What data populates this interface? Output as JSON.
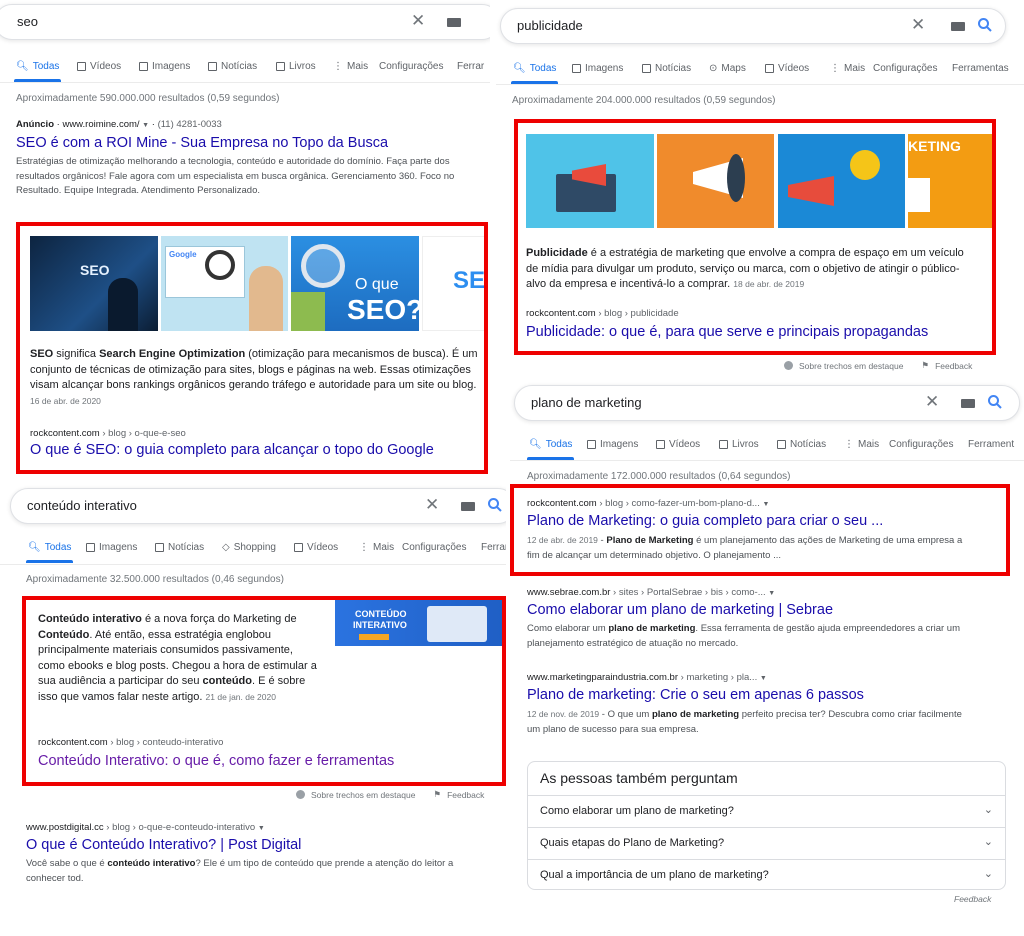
{
  "colors": {
    "link": "#1a0dab",
    "visited": "#681da8",
    "accent": "#1a73e8",
    "highlight_box": "#ee0000"
  },
  "p1": {
    "query": "seo",
    "tabs": [
      "Todas",
      "Vídeos",
      "Imagens",
      "Notícias",
      "Livros",
      "Mais",
      "Configurações",
      "Ferrar"
    ],
    "stats": "Aproximadamente 590.000.000 resultados (0,59 segundos)",
    "ad": {
      "label": "Anúncio",
      "url": "www.roimine.com/",
      "phone": "(11) 4281-0033",
      "title": "SEO é com a ROI Mine - Sua Empresa no Topo da Busca",
      "snippet": "Estratégias de otimização melhorando a tecnologia, conteúdo e autoridade do domínio. Faça parte dos resultados orgânicos! Fale agora com um especialista em busca orgânica. Gerenciamento 360. Foco no Resultado. Equipe Integrada. Atendimento Personalizado."
    },
    "featured": {
      "img_text_1": "SEO",
      "img_text_2": "Google",
      "img_text_3": "O que",
      "img_text_4": "SEO?",
      "img_text_5": "SE",
      "s_bold1": "SEO",
      "s_text1": " significa ",
      "s_bold2": "Search Engine Optimization",
      "s_text2": " (otimização para mecanismos de busca). É um conjunto de técnicas de otimização para sites, blogs e páginas na web. Essas otimizações visam alcançar bons rankings orgânicos gerando tráfego e autoridade para um site ou blog.",
      "date": "16 de abr. de 2020",
      "cite_domain": "rockcontent.com",
      "cite_path": " › blog › o-que-e-seo",
      "title": "O que é SEO: o guia completo para alcançar o topo do Google"
    }
  },
  "p2": {
    "query": "publicidade",
    "tabs": [
      "Todas",
      "Imagens",
      "Notícias",
      "Maps",
      "Vídeos",
      "Mais",
      "Configurações",
      "Ferramentas"
    ],
    "stats": "Aproximadamente 204.000.000 resultados (0,59 segundos)",
    "featured": {
      "img_text_4": "KETING",
      "s_bold1": "Publicidade",
      "s_text1": " é a estratégia de marketing que envolve a compra de espaço em um veículo de mídia para divulgar um produto, serviço ou marca, com o objetivo de atingir o público-alvo da empresa e incentivá-lo a comprar.",
      "date": "18 de abr. de 2019",
      "cite_domain": "rockcontent.com",
      "cite_path": " › blog › publicidade",
      "title": "Publicidade: o que é, para que serve e principais propagandas"
    },
    "about": "Sobre trechos em destaque",
    "feedback": "Feedback"
  },
  "p3": {
    "query": "conteúdo interativo",
    "tabs": [
      "Todas",
      "Imagens",
      "Notícias",
      "Shopping",
      "Vídeos",
      "Mais",
      "Configurações",
      "Ferram"
    ],
    "stats": "Aproximadamente 32.500.000 resultados (0,46 segundos)",
    "featured": {
      "img_line1": "CONTEÚDO",
      "img_line2": "INTERATIVO",
      "s_bold1": "Conteúdo interativo",
      "s_text1": " é a nova força do Marketing de ",
      "s_bold2": "Conteúdo",
      "s_text2": ". Até então, essa estratégia englobou principalmente materiais consumidos passivamente, como ebooks e blog posts. Chegou a hora de estimular a sua audiência a participar do seu ",
      "s_bold3": "conteúdo",
      "s_text3": ". E é sobre isso que vamos falar neste artigo.",
      "date": "21 de jan. de 2020",
      "cite_domain": "rockcontent.com",
      "cite_path": " › blog › conteudo-interativo",
      "title": "Conteúdo Interativo: o que é, como fazer e ferramentas"
    },
    "about": "Sobre trechos em destaque",
    "feedback": "Feedback",
    "result2": {
      "cite_domain": "www.postdigital.cc",
      "cite_path": " › blog › o-que-e-conteudo-interativo",
      "title": "O que é Conteúdo Interativo? | Post Digital",
      "s_text1": "Você sabe o que é ",
      "s_bold1": "conteúdo interativo",
      "s_text2": "? Ele é um tipo de conteúdo que prende a atenção do leitor a conhecer tod."
    }
  },
  "p4": {
    "query": "plano de marketing",
    "tabs": [
      "Todas",
      "Imagens",
      "Vídeos",
      "Livros",
      "Notícias",
      "Mais",
      "Configurações",
      "Ferrament"
    ],
    "stats": "Aproximadamente 172.000.000 resultados (0,64 segundos)",
    "results": [
      {
        "cite_domain": "rockcontent.com",
        "cite_path": " › blog › como-fazer-um-bom-plano-d...",
        "title": "Plano de Marketing: o guia completo para criar o seu ...",
        "date": "12 de abr. de 2019",
        "s_bold1": "Plano de Marketing",
        "s_text1": " é um planejamento das ações de Marketing de uma empresa a fim de alcançar um determinado objetivo. O planejamento ..."
      },
      {
        "cite_domain": "www.sebrae.com.br",
        "cite_path": " › sites › PortalSebrae › bis › como-...",
        "title": "Como elaborar um plano de marketing | Sebrae",
        "s_text0": "Como elaborar um ",
        "s_bold1": "plano de marketing",
        "s_text1": ". Essa ferramenta de gestão ajuda empreendedores a criar um planejamento estratégico de atuação no mercado."
      },
      {
        "cite_domain": "www.marketingparaindustria.com.br",
        "cite_path": " › marketing › pla...",
        "title": "Plano de marketing: Crie o seu em apenas 6 passos",
        "date": "12 de nov. de 2019",
        "s_text0": "O que um ",
        "s_bold1": "plano de marketing",
        "s_text1": " perfeito precisa ter? Descubra como criar facilmente um plano de sucesso para sua empresa."
      }
    ],
    "paa": {
      "title": "As pessoas também perguntam",
      "questions": [
        "Como elaborar um plano de marketing?",
        "Quais etapas do Plano de Marketing?",
        "Qual a importância de um plano de marketing?"
      ]
    },
    "feedback": "Feedback"
  }
}
